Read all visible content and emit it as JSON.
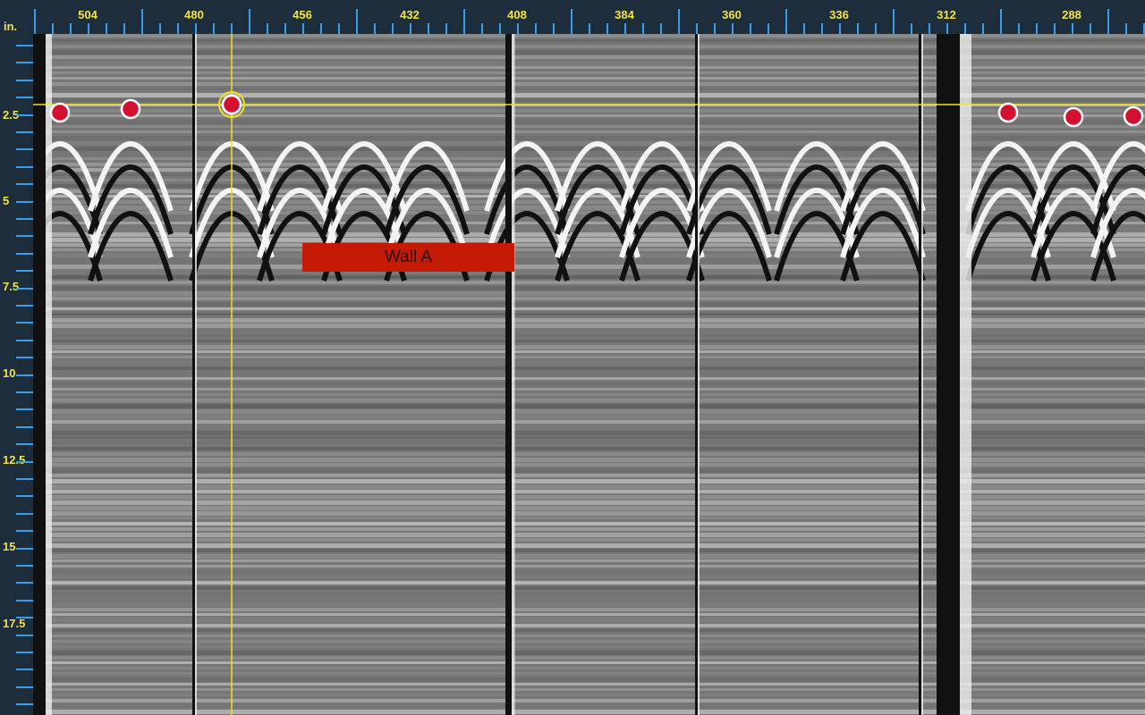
{
  "view": {
    "depth_unit": "in.",
    "x_axis_labels": [
      "504",
      "480",
      "456",
      "432",
      "408",
      "384",
      "360",
      "336",
      "312",
      "288"
    ],
    "y_axis_labels": [
      "2.5",
      "5",
      "7.5",
      "10",
      "12.5",
      "15",
      "17.5"
    ]
  },
  "annotation": {
    "label": "Wall A"
  },
  "colors": {
    "ruler_bg": "#1e2d3b",
    "label_text": "#f2e24a",
    "tick": "#3a9ce6",
    "cursor": "#f0e020",
    "marker": "#d41030",
    "annotation_bg": "#c41a06"
  },
  "markers": [
    "marker-1",
    "marker-2",
    "marker-3-selected",
    "marker-4",
    "marker-5",
    "marker-6"
  ]
}
